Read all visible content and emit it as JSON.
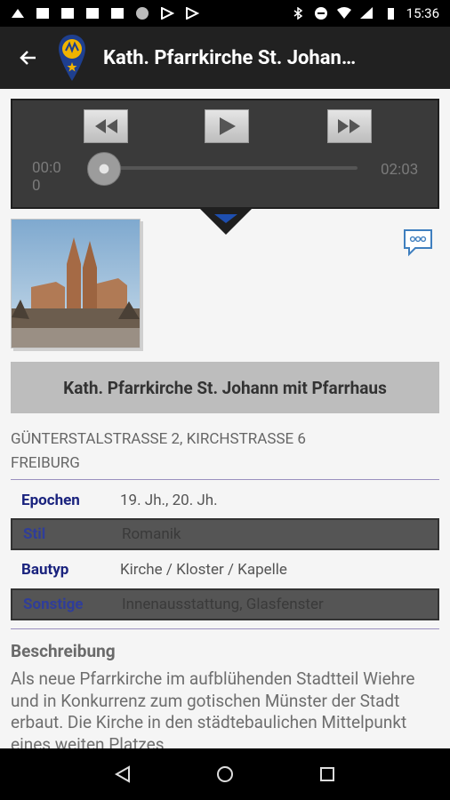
{
  "status_bar": {
    "time": "15:36"
  },
  "app_bar": {
    "title": "Kath. Pfarrkirche St. Johan…",
    "back_icon": "arrow-left-icon",
    "logo_icon": "map-pin-logo-icon"
  },
  "player": {
    "elapsed": "00:0\n0",
    "total": "02:03",
    "rewind_icon": "rewind-icon",
    "play_icon": "play-icon",
    "forward_icon": "fast-forward-icon",
    "progress": 0.0
  },
  "comment_icon": "comment-bubble-icon",
  "monument": {
    "name": "Kath. Pfarrkirche St. Johann mit Pfarrhaus",
    "address_line1": "GÜNTERSTALSTRASSE 2, KIRCHSTRASSE 6",
    "address_line2": "FREIBURG"
  },
  "details": [
    {
      "key": "Epochen",
      "value": "19. Jh., 20. Jh."
    },
    {
      "key": "Stil",
      "value": "Romanik"
    },
    {
      "key": "Bautyp",
      "value": "Kirche / Kloster / Kapelle"
    },
    {
      "key": "Sonstige",
      "value": "Innenausstattung, Glasfenster"
    }
  ],
  "description": {
    "heading": "Beschreibung",
    "text": "Als neue Pfarrkirche im aufblühenden Stadtteil Wiehre und in Konkurrenz zum gotischen Münster der Stadt erbaut. Die Kirche in den städtebaulichen Mittelpunkt eines weiten Platzes"
  },
  "colors": {
    "appbar": "#212121",
    "accent_blue": "#1a237e",
    "player_bg": "#3a3a3a"
  }
}
